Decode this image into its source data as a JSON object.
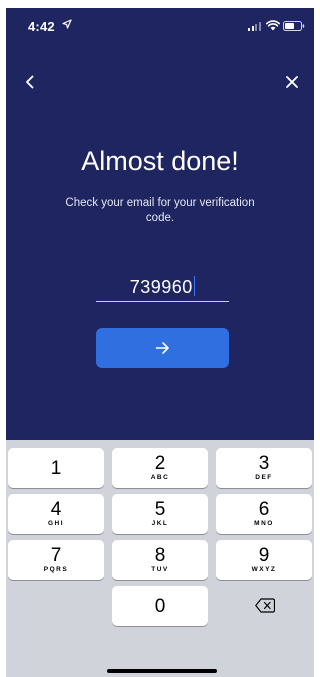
{
  "status_bar": {
    "time": "4:42",
    "location_icon": "location-arrow-icon",
    "signal_icon": "cellular-signal-icon",
    "wifi_icon": "wifi-icon",
    "battery_icon": "battery-icon"
  },
  "nav": {
    "back_icon": "chevron-left-icon",
    "close_icon": "close-icon"
  },
  "verification": {
    "title": "Almost done!",
    "subtitle": "Check your email for your verification code.",
    "code_value": "739960",
    "submit_icon": "arrow-right-icon"
  },
  "keypad": {
    "keys": [
      {
        "digit": "1",
        "letters": ""
      },
      {
        "digit": "2",
        "letters": "ABC"
      },
      {
        "digit": "3",
        "letters": "DEF"
      },
      {
        "digit": "4",
        "letters": "GHI"
      },
      {
        "digit": "5",
        "letters": "JKL"
      },
      {
        "digit": "6",
        "letters": "MNO"
      },
      {
        "digit": "7",
        "letters": "PQRS"
      },
      {
        "digit": "8",
        "letters": "TUV"
      },
      {
        "digit": "9",
        "letters": "WXYZ"
      },
      {
        "digit": "0",
        "letters": ""
      }
    ],
    "delete_icon": "backspace-icon"
  },
  "colors": {
    "background": "#1e2561",
    "button": "#2f6fe0",
    "caret": "#3d74ff",
    "keyboard": "#d0d3da"
  }
}
